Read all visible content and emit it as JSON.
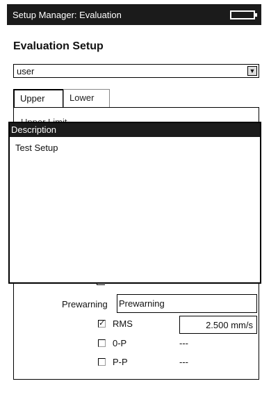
{
  "window": {
    "title": "Setup Manager: Evaluation",
    "battery_icon": "battery-icon"
  },
  "heading": "Evaluation Setup",
  "setup_select": {
    "value": "user",
    "arrow_icon": "dropdown-arrow-icon"
  },
  "tabs": [
    {
      "label": "Upper",
      "active": true
    },
    {
      "label": "Lower",
      "active": false
    }
  ],
  "panel": {
    "section_label": "Upper Limit"
  },
  "description_popup": {
    "header": "Description",
    "text": "Test Setup"
  },
  "prewarning": {
    "label": "Prewarning",
    "value": "Prewarning",
    "rows": [
      {
        "label": "RMS",
        "checked": true,
        "value": "2.500 mm/s"
      },
      {
        "label": "0-P",
        "checked": false,
        "value": "---"
      },
      {
        "label": "P-P",
        "checked": false,
        "value": "---"
      }
    ]
  }
}
